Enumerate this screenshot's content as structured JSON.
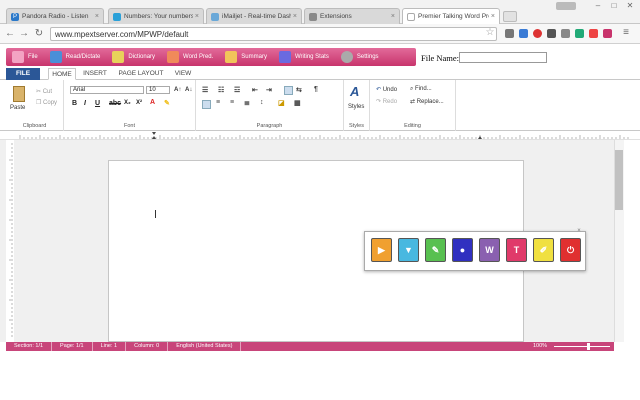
{
  "browser": {
    "tabs": [
      {
        "title": "Pandora Radio - Listen",
        "color": "#2a78c9"
      },
      {
        "title": "Numbers: Your numbers",
        "color": "#2aa0d8"
      },
      {
        "title": "iMailjet - Real-time Dashb",
        "color": "#6aa8d8"
      },
      {
        "title": "Extensions",
        "color": "#8a8a8a"
      },
      {
        "title": "Premier Talking Word Pro",
        "color": "#c8346c"
      }
    ],
    "url": "www.mpextserver.com/MPWP/default"
  },
  "app": {
    "toolbar": [
      {
        "label": "File",
        "color": "#f3a3c3"
      },
      {
        "label": "Read/Dictate",
        "color": "#4a8fd8"
      },
      {
        "label": "Dictionary",
        "color": "#e8d25a"
      },
      {
        "label": "Word Pred.",
        "color": "#f08a5a"
      },
      {
        "label": "Summary",
        "color": "#f1c45a"
      },
      {
        "label": "Writing Stats",
        "color": "#6a6ae0"
      },
      {
        "label": "Settings",
        "color": "#aaaaaa"
      }
    ],
    "filename_label": "File Name:"
  },
  "ribbon": {
    "tabs": [
      "FILE",
      "HOME",
      "INSERT",
      "PAGE LAYOUT",
      "VIEW"
    ],
    "clipboard": {
      "paste": "Paste",
      "cut": "Cut",
      "copy": "Copy",
      "group": "Clipboard"
    },
    "font": {
      "family": "Arial",
      "size": "10",
      "group": "Font"
    },
    "paragraph": {
      "group": "Paragraph"
    },
    "styles": {
      "label": "Styles",
      "group": "Styles"
    },
    "editing": {
      "undo": "Undo",
      "redo": "Redo",
      "find": "Find...",
      "replace": "Replace...",
      "group": "Editing"
    }
  },
  "floatbar": {
    "buttons": [
      {
        "name": "play",
        "color": "#f0a030",
        "glyph": "▶"
      },
      {
        "name": "filter",
        "color": "#48b8e0",
        "glyph": "▼"
      },
      {
        "name": "highlight",
        "color": "#58c050",
        "glyph": "✎"
      },
      {
        "name": "microphone",
        "color": "#3030c0",
        "glyph": "●"
      },
      {
        "name": "word",
        "color": "#8a60b0",
        "glyph": "W"
      },
      {
        "name": "text",
        "color": "#e03a6a",
        "glyph": "T"
      },
      {
        "name": "pencil",
        "color": "#f0e040",
        "glyph": "✐"
      },
      {
        "name": "power",
        "color": "#e03030",
        "glyph": "⏻"
      }
    ]
  },
  "status": {
    "section": "Section: 1/1",
    "page": "Page: 1/1",
    "line": "Line: 1",
    "column": "Column: 0",
    "language": "English (United States)",
    "zoom": "100%"
  }
}
